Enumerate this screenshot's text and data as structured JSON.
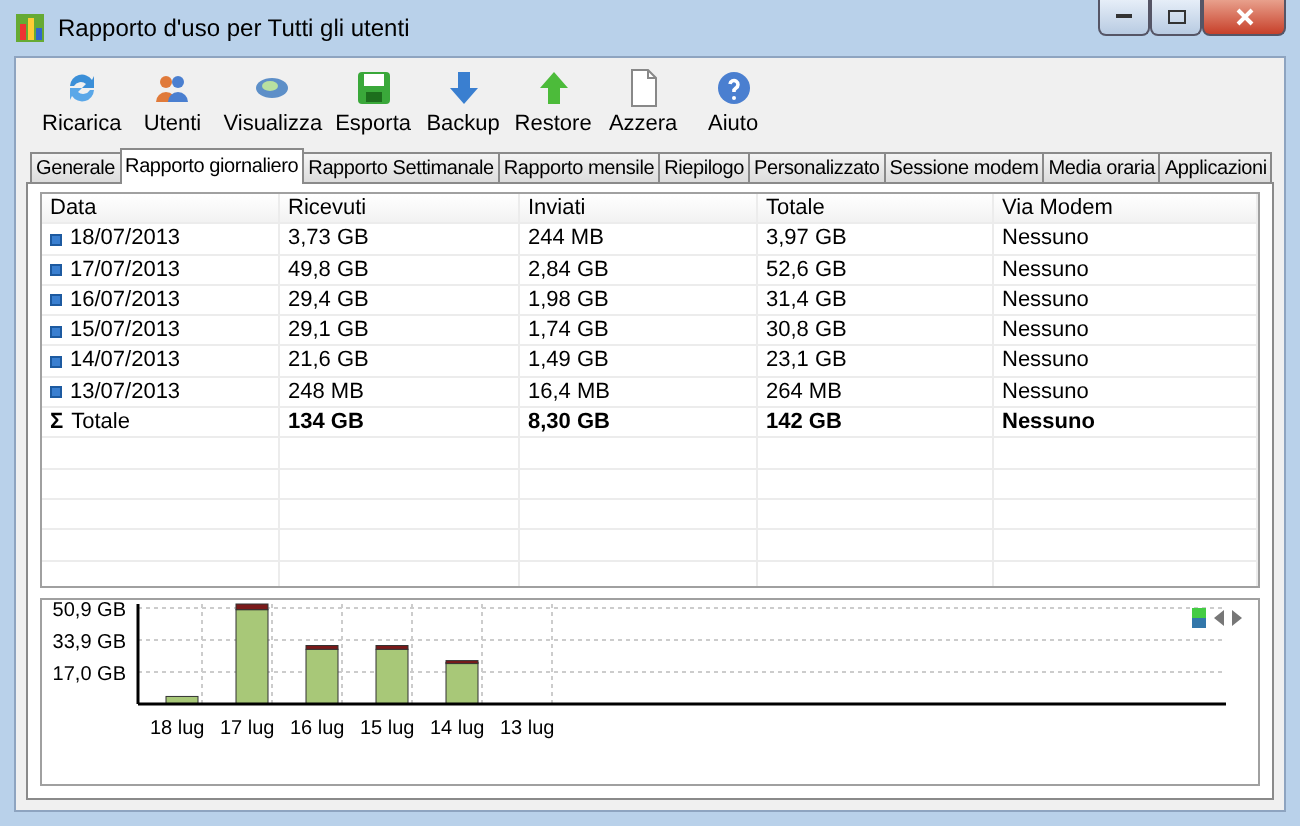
{
  "window": {
    "title": "Rapporto d'uso per Tutti gli utenti"
  },
  "toolbar": [
    {
      "label": "Ricarica",
      "kind": "reload"
    },
    {
      "label": "Utenti",
      "kind": "users"
    },
    {
      "label": "Visualizza",
      "kind": "view"
    },
    {
      "label": "Esporta",
      "kind": "save"
    },
    {
      "label": "Backup",
      "kind": "down"
    },
    {
      "label": "Restore",
      "kind": "up"
    },
    {
      "label": "Azzera",
      "kind": "page"
    },
    {
      "label": "Aiuto",
      "kind": "help"
    }
  ],
  "tabs": [
    {
      "label": "Generale",
      "selected": false
    },
    {
      "label": "Rapporto giornaliero",
      "selected": true
    },
    {
      "label": "Rapporto Settimanale",
      "selected": false
    },
    {
      "label": "Rapporto mensile",
      "selected": false
    },
    {
      "label": "Riepilogo",
      "selected": false
    },
    {
      "label": "Personalizzato",
      "selected": false
    },
    {
      "label": "Sessione modem",
      "selected": false
    },
    {
      "label": "Media oraria",
      "selected": false
    },
    {
      "label": "Applicazioni",
      "selected": false
    }
  ],
  "table": {
    "columns": [
      "Data",
      "Ricevuti",
      "Inviati",
      "Totale",
      "Via Modem"
    ],
    "rows": [
      {
        "kind": "day",
        "cells": [
          "18/07/2013",
          "3,73 GB",
          "244 MB",
          "3,97 GB",
          "Nessuno"
        ]
      },
      {
        "kind": "day",
        "cells": [
          "17/07/2013",
          "49,8 GB",
          "2,84 GB",
          "52,6 GB",
          "Nessuno"
        ]
      },
      {
        "kind": "day",
        "cells": [
          "16/07/2013",
          "29,4 GB",
          "1,98 GB",
          "31,4 GB",
          "Nessuno"
        ]
      },
      {
        "kind": "day",
        "cells": [
          "15/07/2013",
          "29,1 GB",
          "1,74 GB",
          "30,8 GB",
          "Nessuno"
        ]
      },
      {
        "kind": "day",
        "cells": [
          "14/07/2013",
          "21,6 GB",
          "1,49 GB",
          "23,1 GB",
          "Nessuno"
        ]
      },
      {
        "kind": "day",
        "cells": [
          "13/07/2013",
          "248 MB",
          "16,4 MB",
          "264 MB",
          "Nessuno"
        ]
      },
      {
        "kind": "total",
        "symbol": "Σ",
        "cells": [
          "Totale",
          "134 GB",
          "8,30 GB",
          "142 GB",
          "Nessuno"
        ]
      }
    ]
  },
  "chart": {
    "chart_data": {
      "type": "bar",
      "stacked": true,
      "categories": [
        "18 lug",
        "17 lug",
        "16 lug",
        "15 lug",
        "14 lug",
        "13 lug"
      ],
      "series": [
        {
          "color": "#a8c878",
          "values": [
            4,
            50,
            29,
            29,
            22,
            0
          ]
        },
        {
          "color": "#7a1a1a",
          "values": [
            0,
            3,
            2,
            2,
            1,
            0
          ]
        }
      ],
      "ylim": [
        0,
        53
      ],
      "yticks": [
        {
          "value": 17.0,
          "label": "17,0 GB"
        },
        {
          "value": 33.9,
          "label": "33,9 GB"
        },
        {
          "value": 50.9,
          "label": "50,9 GB"
        }
      ]
    }
  }
}
